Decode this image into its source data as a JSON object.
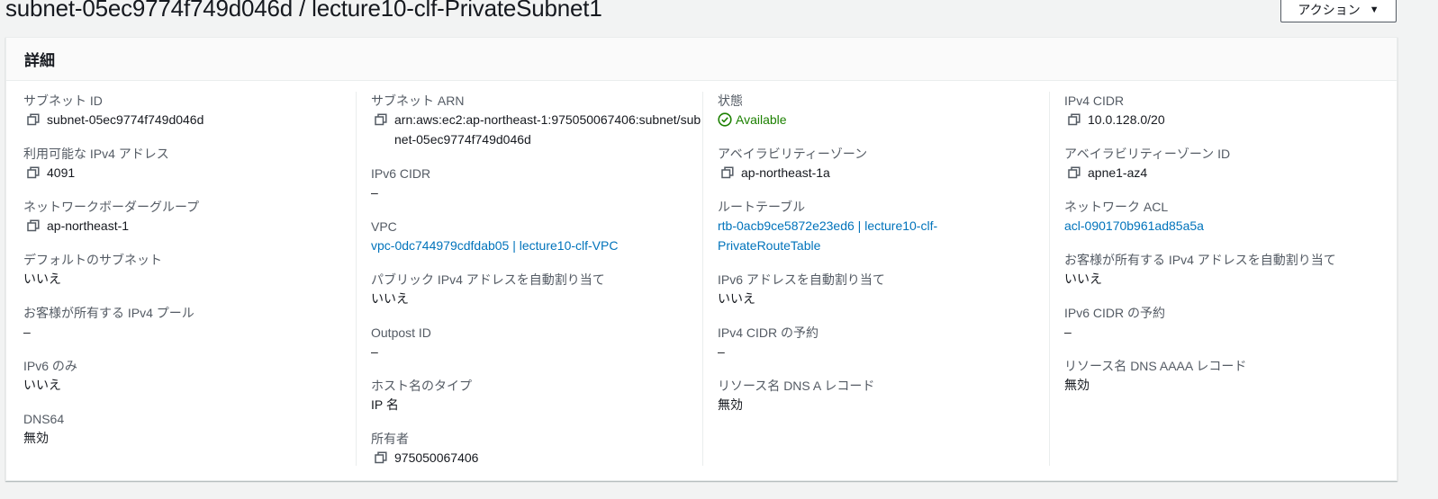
{
  "page": {
    "title": "subnet-05ec9774f749d046d / lecture10-clf-PrivateSubnet1",
    "action_button": "アクション"
  },
  "panel": {
    "heading": "詳細"
  },
  "col1": [
    {
      "label": "サブネット ID",
      "value": "subnet-05ec9774f749d046d"
    },
    {
      "label": "利用可能な IPv4 アドレス",
      "value": "4091"
    },
    {
      "label": "ネットワークボーダーグループ",
      "value": "ap-northeast-1"
    },
    {
      "label": "デフォルトのサブネット",
      "value": "いいえ"
    },
    {
      "label": "お客様が所有する IPv4 プール",
      "value": "–"
    },
    {
      "label": "IPv6 のみ",
      "value": "いいえ"
    },
    {
      "label": "DNS64",
      "value": "無効"
    }
  ],
  "col2": [
    {
      "label": "サブネット ARN",
      "value": "arn:aws:ec2:ap-northeast-1:975050067406:subnet/subnet-05ec9774f749d046d"
    },
    {
      "label": "IPv6 CIDR",
      "value": "–"
    },
    {
      "label": "VPC",
      "value": "vpc-0dc744979cdfdab05 | lecture10-clf-VPC"
    },
    {
      "label": "パブリック IPv4 アドレスを自動割り当て",
      "value": "いいえ"
    },
    {
      "label": "Outpost ID",
      "value": "–"
    },
    {
      "label": "ホスト名のタイプ",
      "value": "IP 名"
    },
    {
      "label": "所有者",
      "value": "975050067406"
    }
  ],
  "col3": [
    {
      "label": "状態",
      "value": "Available"
    },
    {
      "label": "アベイラビリティーゾーン",
      "value": "ap-northeast-1a"
    },
    {
      "label": "ルートテーブル",
      "value": "rtb-0acb9ce5872e23ed6 | lecture10-clf-PrivateRouteTable"
    },
    {
      "label": "IPv6 アドレスを自動割り当て",
      "value": "いいえ"
    },
    {
      "label": "IPv4 CIDR の予約",
      "value": "–"
    },
    {
      "label": "リソース名 DNS A レコード",
      "value": "無効"
    }
  ],
  "col4": [
    {
      "label": "IPv4 CIDR",
      "value": "10.0.128.0/20"
    },
    {
      "label": "アベイラビリティーゾーン ID",
      "value": "apne1-az4"
    },
    {
      "label": "ネットワーク ACL",
      "value": "acl-090170b961ad85a5a"
    },
    {
      "label": "お客様が所有する IPv4 アドレスを自動割り当て",
      "value": "いいえ"
    },
    {
      "label": "IPv6 CIDR の予約",
      "value": "–"
    },
    {
      "label": "リソース名 DNS AAAA レコード",
      "value": "無効"
    }
  ],
  "colors": {
    "link": "#0073bb",
    "status_available": "#1d8102",
    "label": "#545b64"
  },
  "icons": {
    "copy": "copy-icon",
    "status": "check-circle-icon",
    "caret": "caret-down-icon"
  }
}
